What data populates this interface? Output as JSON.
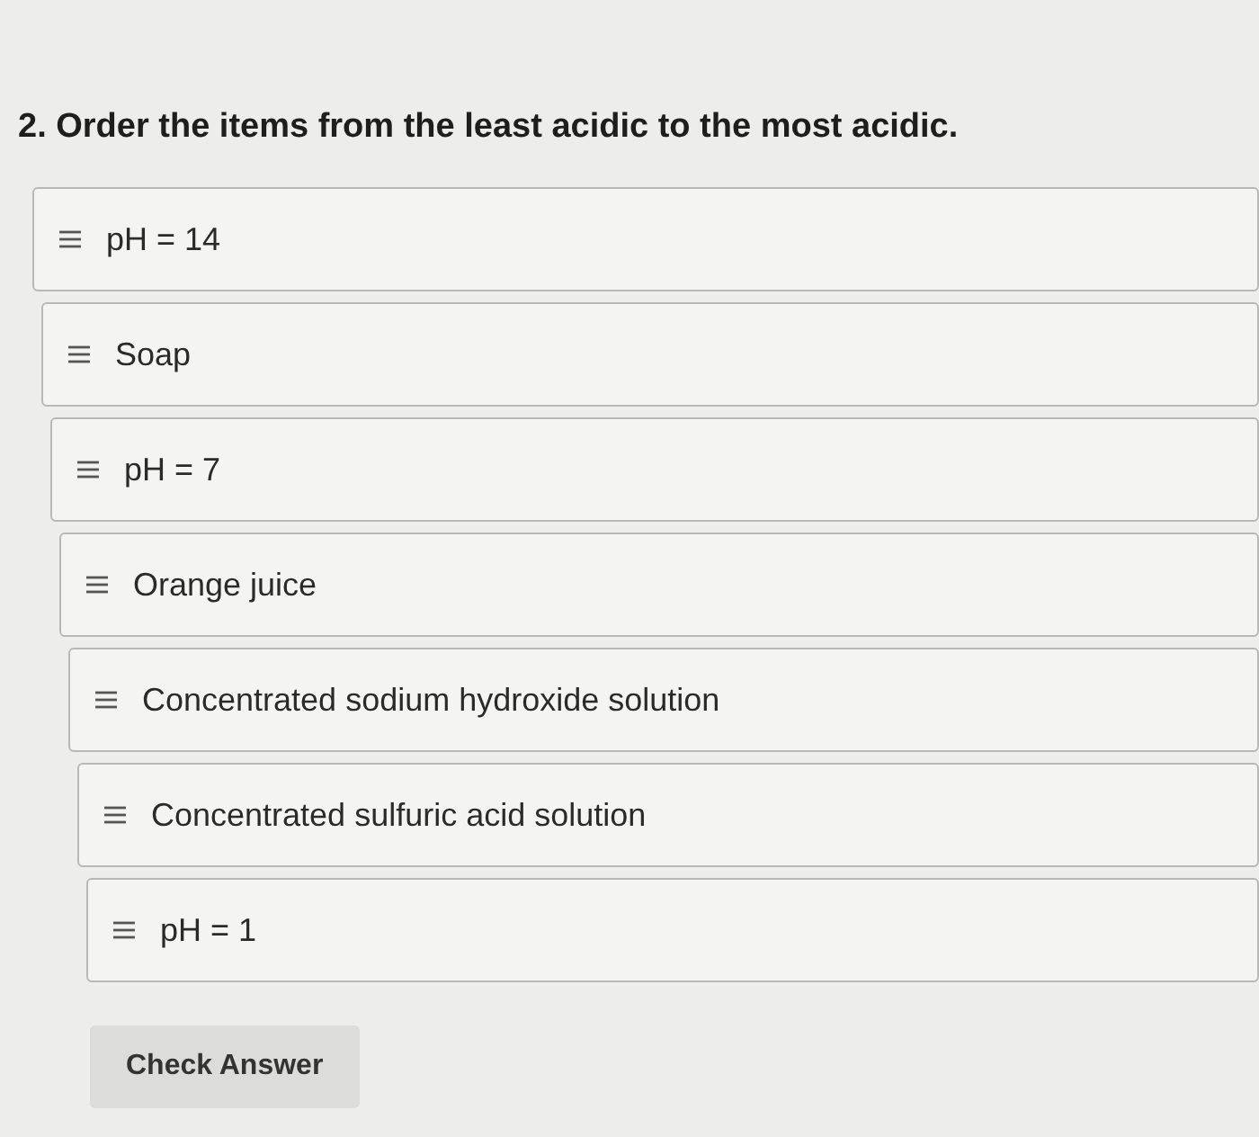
{
  "question": {
    "title": "2. Order the items from the least acidic to the most acidic."
  },
  "items": [
    {
      "label": "pH = 14"
    },
    {
      "label": "Soap"
    },
    {
      "label": "pH = 7"
    },
    {
      "label": "Orange juice"
    },
    {
      "label": "Concentrated sodium hydroxide solution"
    },
    {
      "label": "Concentrated sulfuric acid solution"
    },
    {
      "label": "pH = 1"
    }
  ],
  "buttons": [
    {
      "label": "Check Answer"
    }
  ]
}
